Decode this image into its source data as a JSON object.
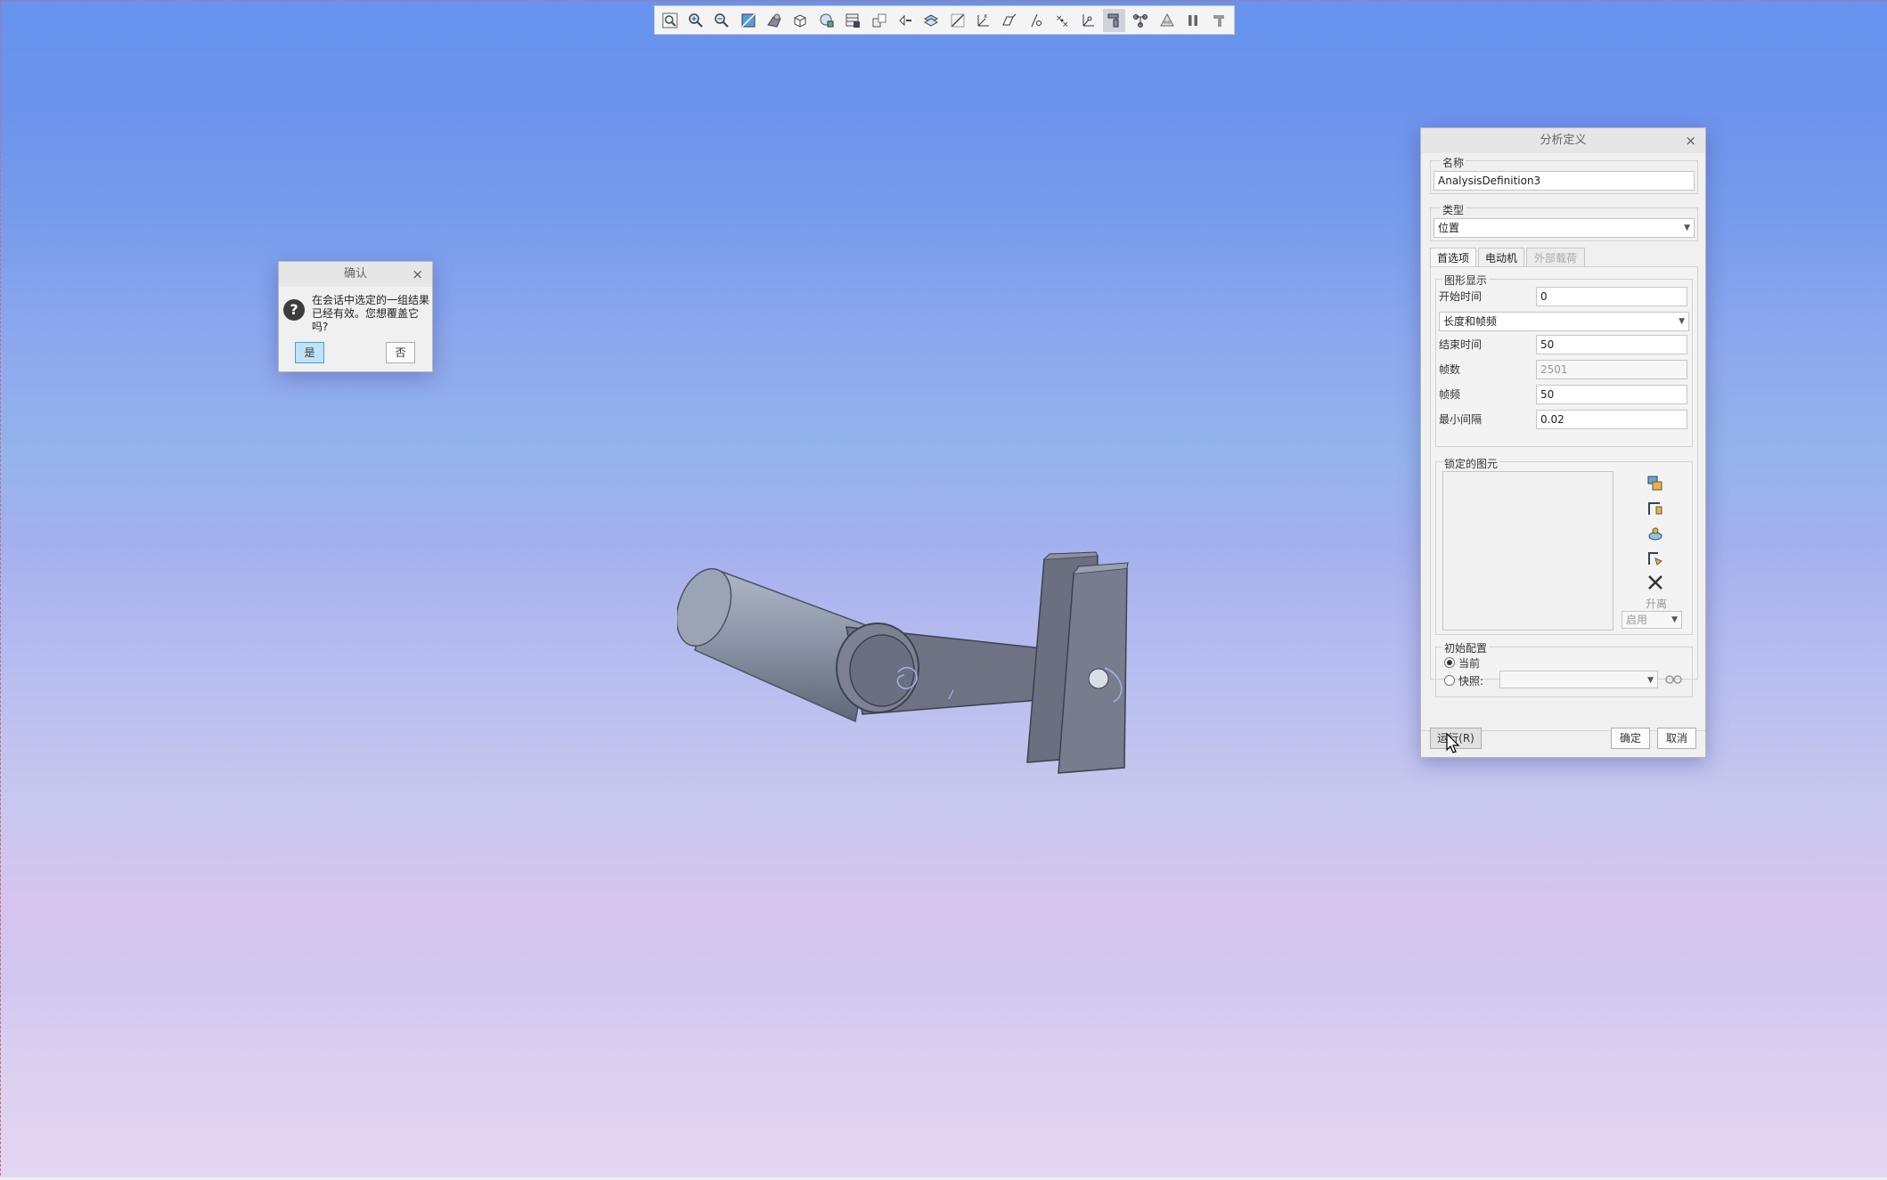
{
  "toolbar": {
    "icons": [
      "zoom-fit-icon",
      "zoom-in-icon",
      "zoom-out-icon",
      "refit-icon",
      "shading-icon",
      "view-cube-icon",
      "saved-views-icon",
      "layers-icon",
      "display-style-icon",
      "datum-planes-icon",
      "datum-axes-icon",
      "datum-points-icon",
      "coordinate-systems-icon",
      "annotations-icon",
      "spin-center-icon",
      "connections-icon",
      "mechanism-icon",
      "joints-icon",
      "motors-icon",
      "pause-icon",
      "stop-icon"
    ]
  },
  "confirm_dialog": {
    "title": "确认",
    "close": "×",
    "message_line1": "在会话中选定的一组结果",
    "message_line2": "已经有效。您想覆盖它吗?",
    "yes_label": "是",
    "no_label": "否",
    "icon": "question-icon"
  },
  "analysis_dialog": {
    "title": "分析定义",
    "close": "×",
    "name_label": "名称",
    "name_value": "AnalysisDefinition3",
    "type_label": "类型",
    "type_value": "位置",
    "tabs": [
      {
        "label": "首选项",
        "state": "active"
      },
      {
        "label": "电动机",
        "state": "normal"
      },
      {
        "label": "外部载荷",
        "state": "disabled"
      }
    ],
    "graphic_display_label": "图形显示",
    "start_time_label": "开始时间",
    "start_time_value": "0",
    "mode_value": "长度和帧频",
    "end_time_label": "结束时间",
    "end_time_value": "50",
    "frames_label": "帧数",
    "frames_value": "2501",
    "frame_rate_label": "帧频",
    "frame_rate_value": "50",
    "min_interval_label": "最小间隔",
    "min_interval_value": "0.02",
    "locked_entities_label": "锁定的图元",
    "lift_label": "升离",
    "enable_label": "启用",
    "initial_config_label": "初始配置",
    "current_label": "当前",
    "snapshot_label": "快照:",
    "run_label": "运行(R)",
    "ok_label": "确定",
    "cancel_label": "取消"
  }
}
